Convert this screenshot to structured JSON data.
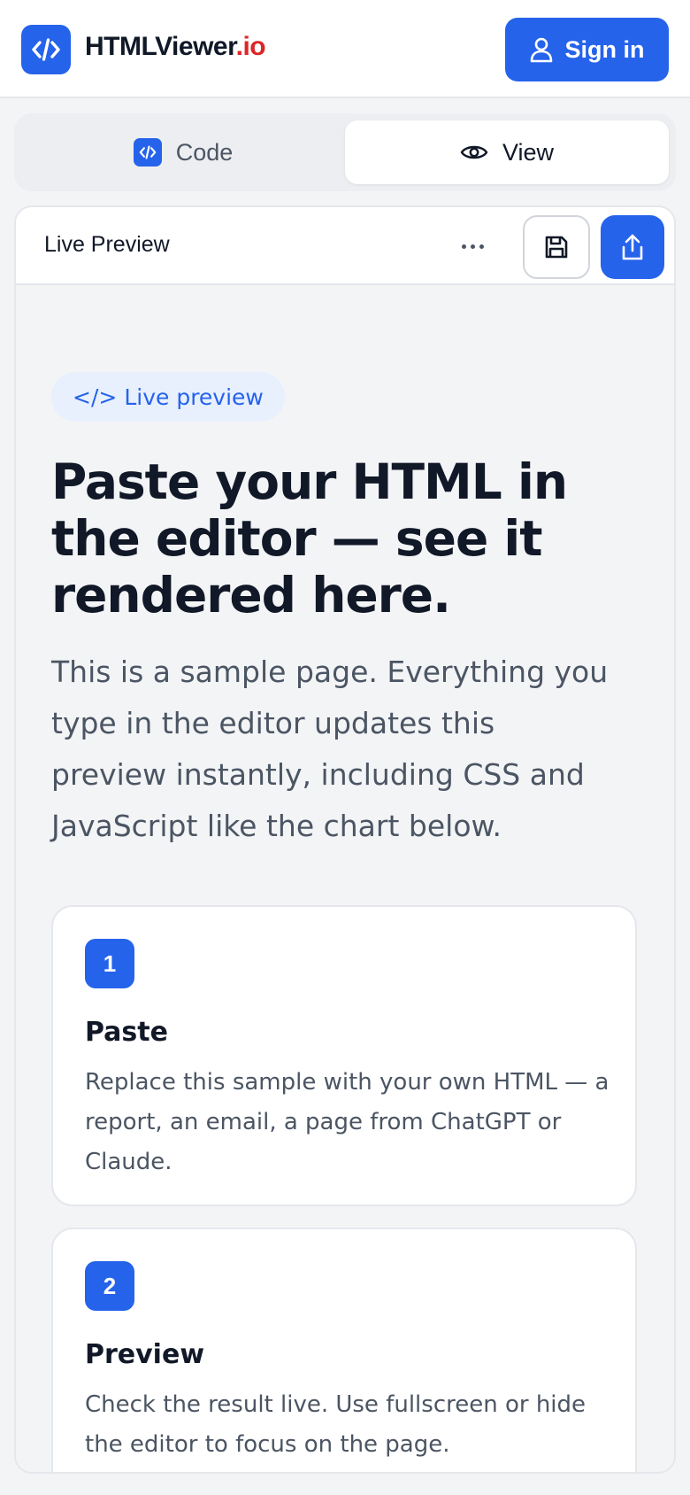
{
  "header": {
    "brand_main": "HTMLViewer",
    "brand_suffix": ".io",
    "signin_label": "Sign in"
  },
  "tabs": {
    "code_label": "Code",
    "view_label": "View",
    "active": "View"
  },
  "panel": {
    "title": "Live Preview"
  },
  "preview": {
    "pill_icon_text": "</>",
    "pill_label": "Live preview",
    "title": "Paste your HTML in the editor — see it rendered here.",
    "description": "This is a sample page. Everything you type in the editor updates this preview instantly, including CSS and JavaScript like the chart below.",
    "steps": [
      {
        "number": "1",
        "title": "Paste",
        "text": "Replace this sample with your own HTML — a report, an email, a page from ChatGPT or Claude."
      },
      {
        "number": "2",
        "title": "Preview",
        "text": "Check the result live. Use fullscreen or hide the editor to focus on the page."
      }
    ]
  },
  "colors": {
    "accent": "#2563eb",
    "brand_suffix": "#dc2626",
    "background": "#f3f4f6"
  },
  "icons": {
    "logo": "code-brackets-icon",
    "signin": "user-icon",
    "view_tab": "eye-icon",
    "more": "more-horizontal-icon",
    "save": "save-icon",
    "share": "share-icon"
  }
}
